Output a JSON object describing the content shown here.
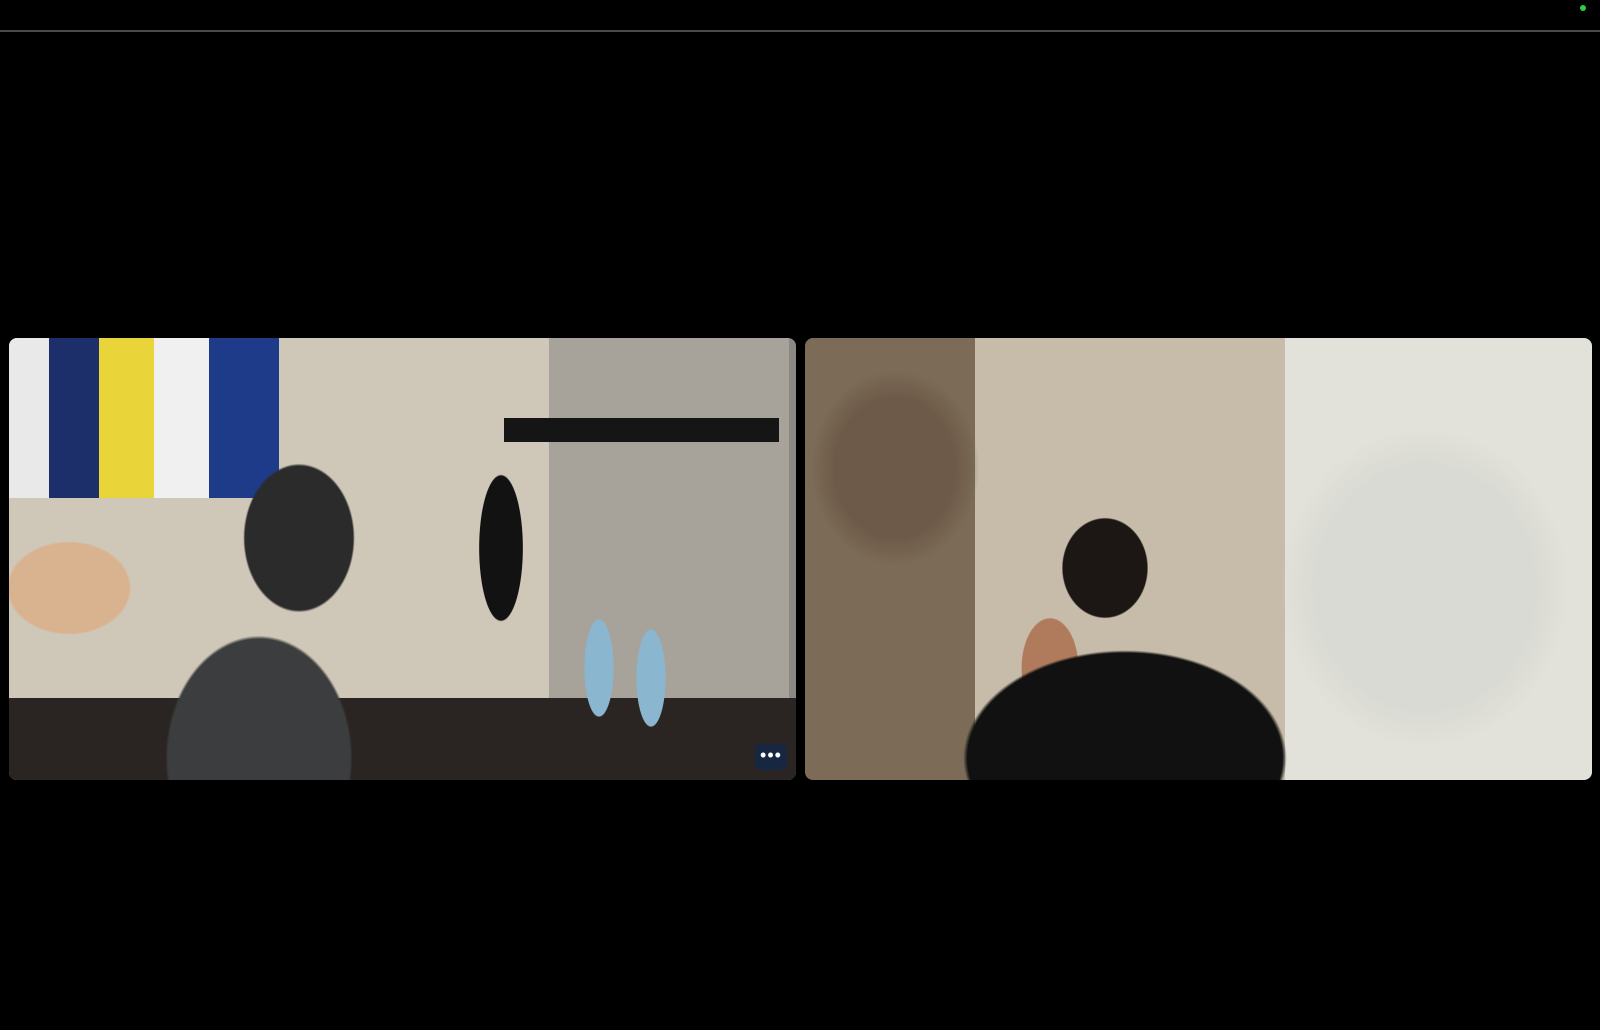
{
  "window": {
    "status_color": "#2ecc40"
  },
  "tiles": [
    {
      "id": "participant-1",
      "more_icon": "ellipsis-icon",
      "more_label": "•••"
    },
    {
      "id": "participant-2"
    }
  ]
}
